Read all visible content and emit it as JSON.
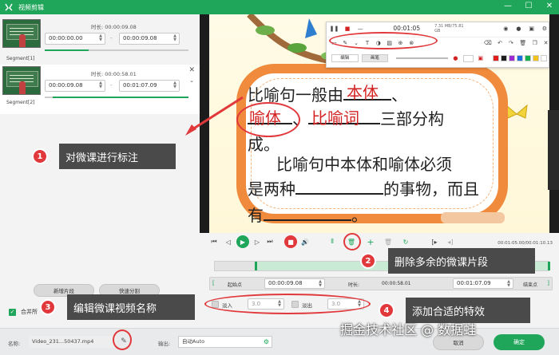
{
  "window": {
    "title": "视频剪辑",
    "minimize": "—",
    "maximize": "☐",
    "close": "✕"
  },
  "segments": [
    {
      "label": "Segment[1]",
      "duration_label": "时长:",
      "duration": "00:00:09.08",
      "start": "00:00:00.00",
      "end": "00:00:09.08"
    },
    {
      "label": "Segment[2]",
      "duration_label": "时长:",
      "duration": "00:00:58.01",
      "start": "00:00:09.08",
      "end": "00:01:07.09"
    }
  ],
  "left_buttons": {
    "add_segment": "新增片段",
    "quick_split": "快速分割"
  },
  "merge_label": "合并所",
  "bottom": {
    "name_label": "名称:",
    "file_name": "Video_231...50437.mp4",
    "output_label": "输出:",
    "output_value": "自动Auto",
    "cancel": "取消",
    "confirm": "确定"
  },
  "toolbar": {
    "time": "00:01:05",
    "size": "7.31 MB/75.81 GB",
    "modes": [
      "编辑",
      "画笔"
    ],
    "colors": [
      "#e01e1e",
      "#1e1e1e",
      "#9d2bd4",
      "#1a6ee0",
      "#12b04a",
      "#f2c31a",
      "#ffffff"
    ]
  },
  "lesson": {
    "line1": "比喻句一般由",
    "word_body": "本体",
    "comma1": "、",
    "word_vehicle": "喻体",
    "comma2": "、",
    "word_marker": "比喻词",
    "line2_tail": "三部分构",
    "line3": "成。",
    "line4": "比喻句中本体和喻体必须",
    "line5_head": "是两种",
    "line5_tail": "的事物，而且",
    "line6_head": "有",
    "line6_tail": "。"
  },
  "player": {
    "time_display": "00:01:05.00/00:01:10.13"
  },
  "trim": {
    "start_label": "起始点",
    "start": "00:00:09.08",
    "duration_label": "时长:",
    "duration": "00:00:58.01",
    "end": "00:01:07.09",
    "end_label": "结束点"
  },
  "effects": {
    "fade_in_label": "淡入",
    "fade_in": "3.0",
    "fade_out_label": "淡出",
    "fade_out": "3.0"
  },
  "annotations": [
    {
      "num": "1",
      "text": "对微课进行标注"
    },
    {
      "num": "2",
      "text": "删除多余的微课片段"
    },
    {
      "num": "3",
      "text": "编辑微课视频名称"
    },
    {
      "num": "4",
      "text": "添加合适的特效"
    }
  ],
  "watermark": "掘金技术社区 @ 数据蛙"
}
